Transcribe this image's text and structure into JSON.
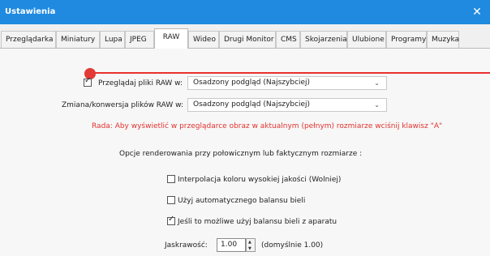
{
  "window": {
    "title": "Ustawienia",
    "close_icon": "close-icon"
  },
  "tabs": [
    {
      "label": "Przeglądarka"
    },
    {
      "label": "Miniatury"
    },
    {
      "label": "Lupa"
    },
    {
      "label": "JPEG"
    },
    {
      "label": "RAW",
      "active": true
    },
    {
      "label": "Wideo"
    },
    {
      "label": "Drugi Monitor"
    },
    {
      "label": "CMS"
    },
    {
      "label": "Skojarzenia"
    },
    {
      "label": "Ulubione"
    },
    {
      "label": "Programy"
    },
    {
      "label": "Muzyka"
    }
  ],
  "raw": {
    "browse_label": "Przeglądaj pliki RAW w:",
    "browse_checked": true,
    "browse_value": "Osadzony podgląd (Najszybciej)",
    "convert_label": "Zmiana/konwersja plików RAW w:",
    "convert_value": "Osadzony podgląd (Najszybciej)",
    "hint": "Rada: Aby wyświetlić w przeglądarce obraz w aktualnym (pełnym) rozmiarze wciśnij klawisz \"A\"",
    "render_heading": "Opcje renderowania przy połowicznym lub faktycznym rozmiarze :",
    "options": [
      {
        "label": "Interpolacja koloru wysokiej jakości (Wolniej)",
        "checked": false
      },
      {
        "label": "Użyj automatycznego balansu bieli",
        "checked": false
      },
      {
        "label": "Jeśli to możliwe użyj balansu bieli z aparatu",
        "checked": true
      }
    ],
    "brightness_label": "Jaskrawość:",
    "brightness_value": "1.00",
    "brightness_default": "(domyślnie 1.00)"
  },
  "colors": {
    "titlebar": "#1f8ae0",
    "annotation_red": "#e8312f",
    "hint_red": "#e0322f"
  }
}
